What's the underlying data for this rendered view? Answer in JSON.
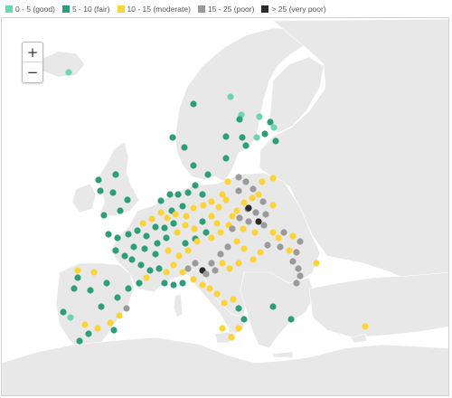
{
  "legend": [
    {
      "label": "0 - 5 (good)",
      "color": "#6dd6b0"
    },
    {
      "label": "5 - 10 (fair)",
      "color": "#2e9e78"
    },
    {
      "label": "10 - 15 (moderate)",
      "color": "#fcd43a"
    },
    {
      "label": "15 - 25 (poor)",
      "color": "#9a9a9a"
    },
    {
      "label": "> 25 (very poor)",
      "color": "#2b2b2b"
    }
  ],
  "zoom": {
    "in_label": "+",
    "out_label": "−"
  },
  "map": {
    "land_color": "#e8e8e8",
    "water_color": "#ffffff"
  }
}
